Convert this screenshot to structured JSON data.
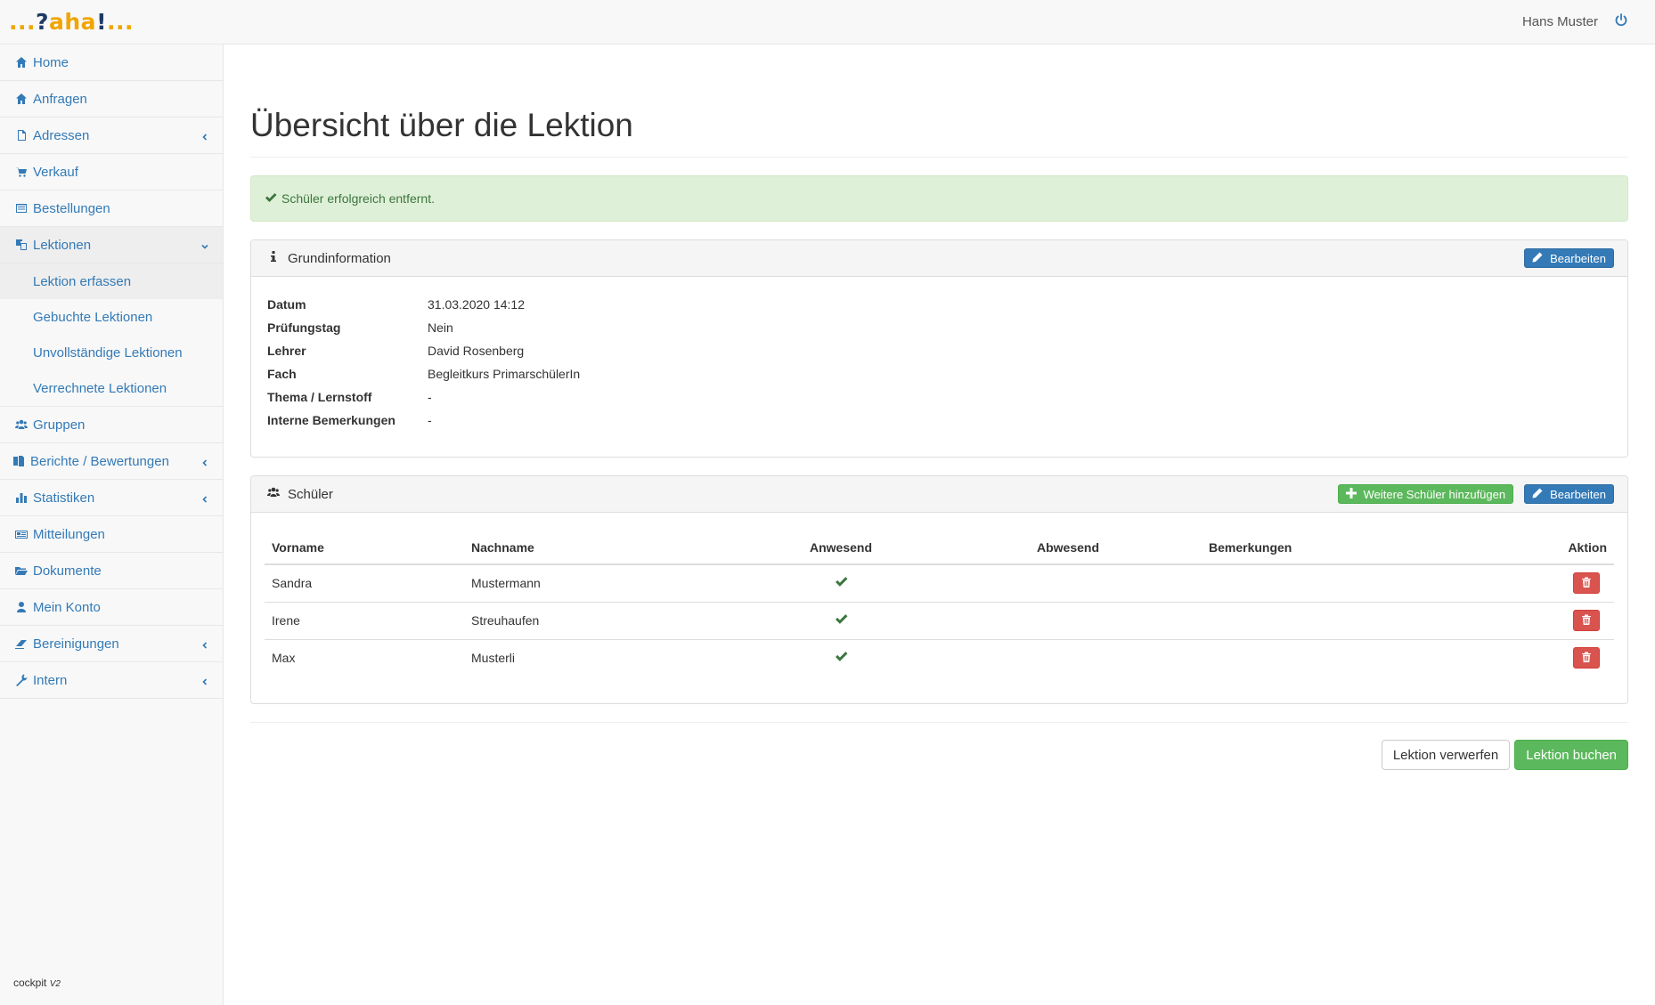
{
  "logo": {
    "dots_left": "...",
    "q": "?",
    "aha": "aha",
    "bang": "!",
    "dots_right": "..."
  },
  "user": {
    "name": "Hans Muster"
  },
  "sidebar": {
    "items": [
      {
        "label": "Home",
        "icon": "home-icon"
      },
      {
        "label": "Anfragen",
        "icon": "home-icon"
      },
      {
        "label": "Adressen",
        "icon": "file-icon",
        "expandable": true
      },
      {
        "label": "Verkauf",
        "icon": "cart-icon"
      },
      {
        "label": "Bestellungen",
        "icon": "list-icon"
      },
      {
        "label": "Lektionen",
        "icon": "copy-icon",
        "expanded": true
      },
      {
        "label": "Gruppen",
        "icon": "users-icon"
      },
      {
        "label": "Berichte / Bewertungen",
        "icon": "files-icon",
        "expandable": true
      },
      {
        "label": "Statistiken",
        "icon": "bar-chart-icon",
        "expandable": true
      },
      {
        "label": "Mitteilungen",
        "icon": "newspaper-icon"
      },
      {
        "label": "Dokumente",
        "icon": "folder-icon"
      },
      {
        "label": "Mein Konto",
        "icon": "user-icon"
      },
      {
        "label": "Bereinigungen",
        "icon": "eraser-icon",
        "expandable": true
      },
      {
        "label": "Intern",
        "icon": "wrench-icon",
        "expandable": true
      }
    ],
    "lektionen_sub": [
      "Lektion erfassen",
      "Gebuchte Lektionen",
      "Unvollständige Lektionen",
      "Verrechnete Lektionen"
    ],
    "version": "cockpit",
    "version_suffix": "V2"
  },
  "main": {
    "title": "Übersicht über die Lektion",
    "alert": "Schüler erfolgreich entfernt.",
    "info_panel": {
      "title": "Grundinformation",
      "edit_label": "Bearbeiten",
      "rows": [
        {
          "label": "Datum",
          "value": "31.03.2020 14:12"
        },
        {
          "label": "Prüfungstag",
          "value": "Nein"
        },
        {
          "label": "Lehrer",
          "value": "David Rosenberg"
        },
        {
          "label": "Fach",
          "value": "Begleitkurs PrimarschülerIn"
        },
        {
          "label": "Thema / Lernstoff",
          "value": "-"
        },
        {
          "label": "Interne Bemerkungen",
          "value": "-"
        }
      ]
    },
    "students_panel": {
      "title": "Schüler",
      "add_label": "Weitere Schüler hinzufügen",
      "edit_label": "Bearbeiten",
      "headers": [
        "Vorname",
        "Nachname",
        "Anwesend",
        "Abwesend",
        "Bemerkungen",
        "Aktion"
      ],
      "rows": [
        {
          "vorname": "Sandra",
          "nachname": "Mustermann",
          "anwesend": true
        },
        {
          "vorname": "Irene",
          "nachname": "Streuhaufen",
          "anwesend": true
        },
        {
          "vorname": "Max",
          "nachname": "Musterli",
          "anwesend": true
        }
      ]
    },
    "discard_label": "Lektion verwerfen",
    "book_label": "Lektion buchen"
  },
  "colors": {
    "primary": "#337ab7",
    "success": "#5cb85c",
    "danger": "#d9534f",
    "alert_bg": "#dff0d8",
    "logo_orange": "#f0a500",
    "logo_navy": "#1f3a66"
  }
}
